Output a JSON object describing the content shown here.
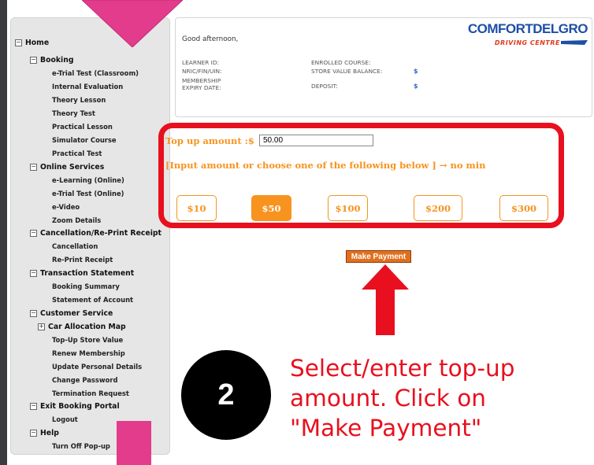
{
  "sidebar": {
    "items": [
      {
        "label": "Home",
        "toggle": "⊟"
      },
      {
        "label": "Booking",
        "toggle": "⊟"
      },
      {
        "label": "e-Trial Test (Classroom)"
      },
      {
        "label": "Internal Evaluation"
      },
      {
        "label": "Theory Lesson"
      },
      {
        "label": "Theory Test"
      },
      {
        "label": "Practical Lesson"
      },
      {
        "label": "Simulator Course"
      },
      {
        "label": "Practical Test"
      },
      {
        "label": "Online Services",
        "toggle": "⊟"
      },
      {
        "label": "e-Learning (Online)"
      },
      {
        "label": "e-Trial Test (Online)"
      },
      {
        "label": "e-Video"
      },
      {
        "label": "Zoom Details"
      },
      {
        "label": "Cancellation/Re-Print Receipt",
        "toggle": "⊟"
      },
      {
        "label": "Cancellation"
      },
      {
        "label": "Re-Print Receipt"
      },
      {
        "label": "Transaction Statement",
        "toggle": "⊟"
      },
      {
        "label": "Booking Summary"
      },
      {
        "label": "Statement of Account"
      },
      {
        "label": "Customer Service",
        "toggle": "⊟"
      },
      {
        "label": "Car Allocation Map",
        "toggle": "⊞"
      },
      {
        "label": "Top-Up Store Value"
      },
      {
        "label": "Renew Membership"
      },
      {
        "label": "Update Personal Details"
      },
      {
        "label": "Change Password"
      },
      {
        "label": "Termination Request"
      },
      {
        "label": "Exit Booking Portal",
        "toggle": "⊟"
      },
      {
        "label": "Logout"
      },
      {
        "label": "Help",
        "toggle": "⊟"
      },
      {
        "label": "Turn Off Pop-up"
      }
    ]
  },
  "header": {
    "greeting": "Good afternoon,",
    "learner_id": "LEARNER ID:",
    "nric": "NRIC/FIN/UIN:",
    "membership": "MEMBERSHIP EXPIRY DATE:",
    "enrolled": "ENROLLED COURSE:",
    "store_value": "STORE VALUE BALANCE:",
    "deposit": "DEPOSIT:",
    "currency": "$",
    "logo_main": "COMFORTDELGRO",
    "logo_sub": "DRIVING CENTRE"
  },
  "topup": {
    "label": "Top up amount :$",
    "value": "50.00",
    "hint": "[Input amount or choose one of the following below ] → no min",
    "amounts": [
      "$10",
      "$50",
      "$100",
      "$200",
      "$300"
    ],
    "selected": "$50",
    "pay_button": "Make Payment"
  },
  "overlay": {
    "step": "2",
    "instruction_lines": [
      "Select/enter top-up",
      "amount. Click on",
      "\"Make Payment\""
    ]
  },
  "colors": {
    "accent_orange": "#f7931e",
    "annotation_red": "#e8101e",
    "annotation_pink": "#e33c8c",
    "logo_blue": "#1d4fa6"
  }
}
